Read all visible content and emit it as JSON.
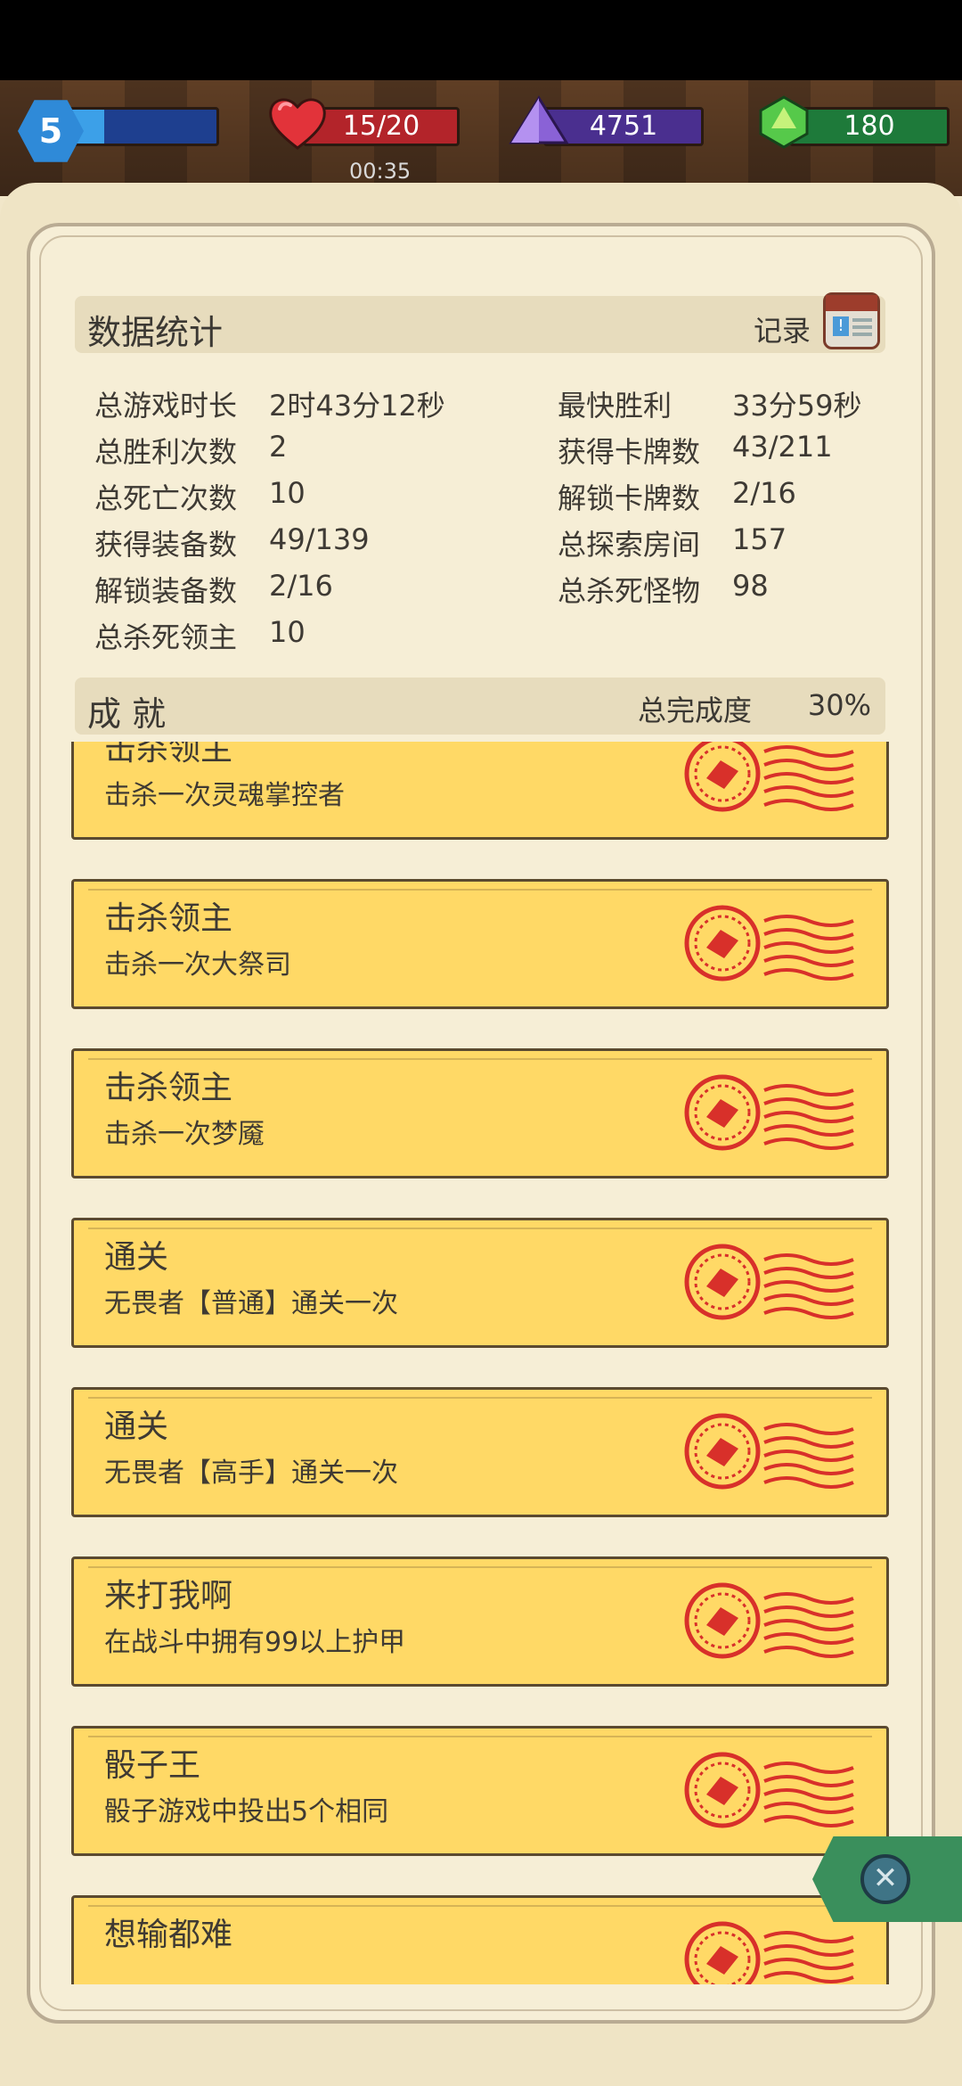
{
  "hud": {
    "level": "5",
    "health": "15/20",
    "crystals": "4751",
    "gems": "180",
    "timer_peek": "00:35",
    "colors": {
      "health": "#b3242a",
      "crystal": "#4a2f8f",
      "gem": "#1e7a3a",
      "xp": "#2a6cc7"
    }
  },
  "stats": {
    "title": "数据统计",
    "records_label": "记录",
    "left": [
      {
        "label": "总游戏时长",
        "value": "2时43分12秒"
      },
      {
        "label": "总胜利次数",
        "value": "2"
      },
      {
        "label": "总死亡次数",
        "value": "10"
      },
      {
        "label": "获得装备数",
        "value": "49/139"
      },
      {
        "label": "解锁装备数",
        "value": "2/16"
      },
      {
        "label": "总杀死领主",
        "value": "10"
      }
    ],
    "right": [
      {
        "label": "最快胜利",
        "value": "33分59秒"
      },
      {
        "label": "获得卡牌数",
        "value": "43/211"
      },
      {
        "label": "解锁卡牌数",
        "value": "2/16"
      },
      {
        "label": "总探索房间",
        "value": "157"
      },
      {
        "label": "总杀死怪物",
        "value": "98"
      }
    ]
  },
  "achievements": {
    "title": "成 就",
    "completion_label": "总完成度",
    "completion_value": "30%",
    "items": [
      {
        "title": "击杀领主",
        "desc": "击杀一次灵魂掌控者"
      },
      {
        "title": "击杀领主",
        "desc": "击杀一次大祭司"
      },
      {
        "title": "击杀领主",
        "desc": "击杀一次梦魇"
      },
      {
        "title": "通关",
        "desc": "无畏者【普通】通关一次"
      },
      {
        "title": "通关",
        "desc": "无畏者【高手】通关一次"
      },
      {
        "title": "来打我啊",
        "desc": "在战斗中拥有99以上护甲"
      },
      {
        "title": "骰子王",
        "desc": "骰子游戏中投出5个相同"
      },
      {
        "title": "想输都难",
        "desc": ""
      }
    ]
  },
  "icons": {
    "level": "hexagon-level-icon",
    "health": "heart-icon",
    "crystal": "crystal-icon",
    "gem": "gem-icon",
    "records": "record-book-icon",
    "stamp": "completed-stamp-icon",
    "close": "close-icon"
  }
}
